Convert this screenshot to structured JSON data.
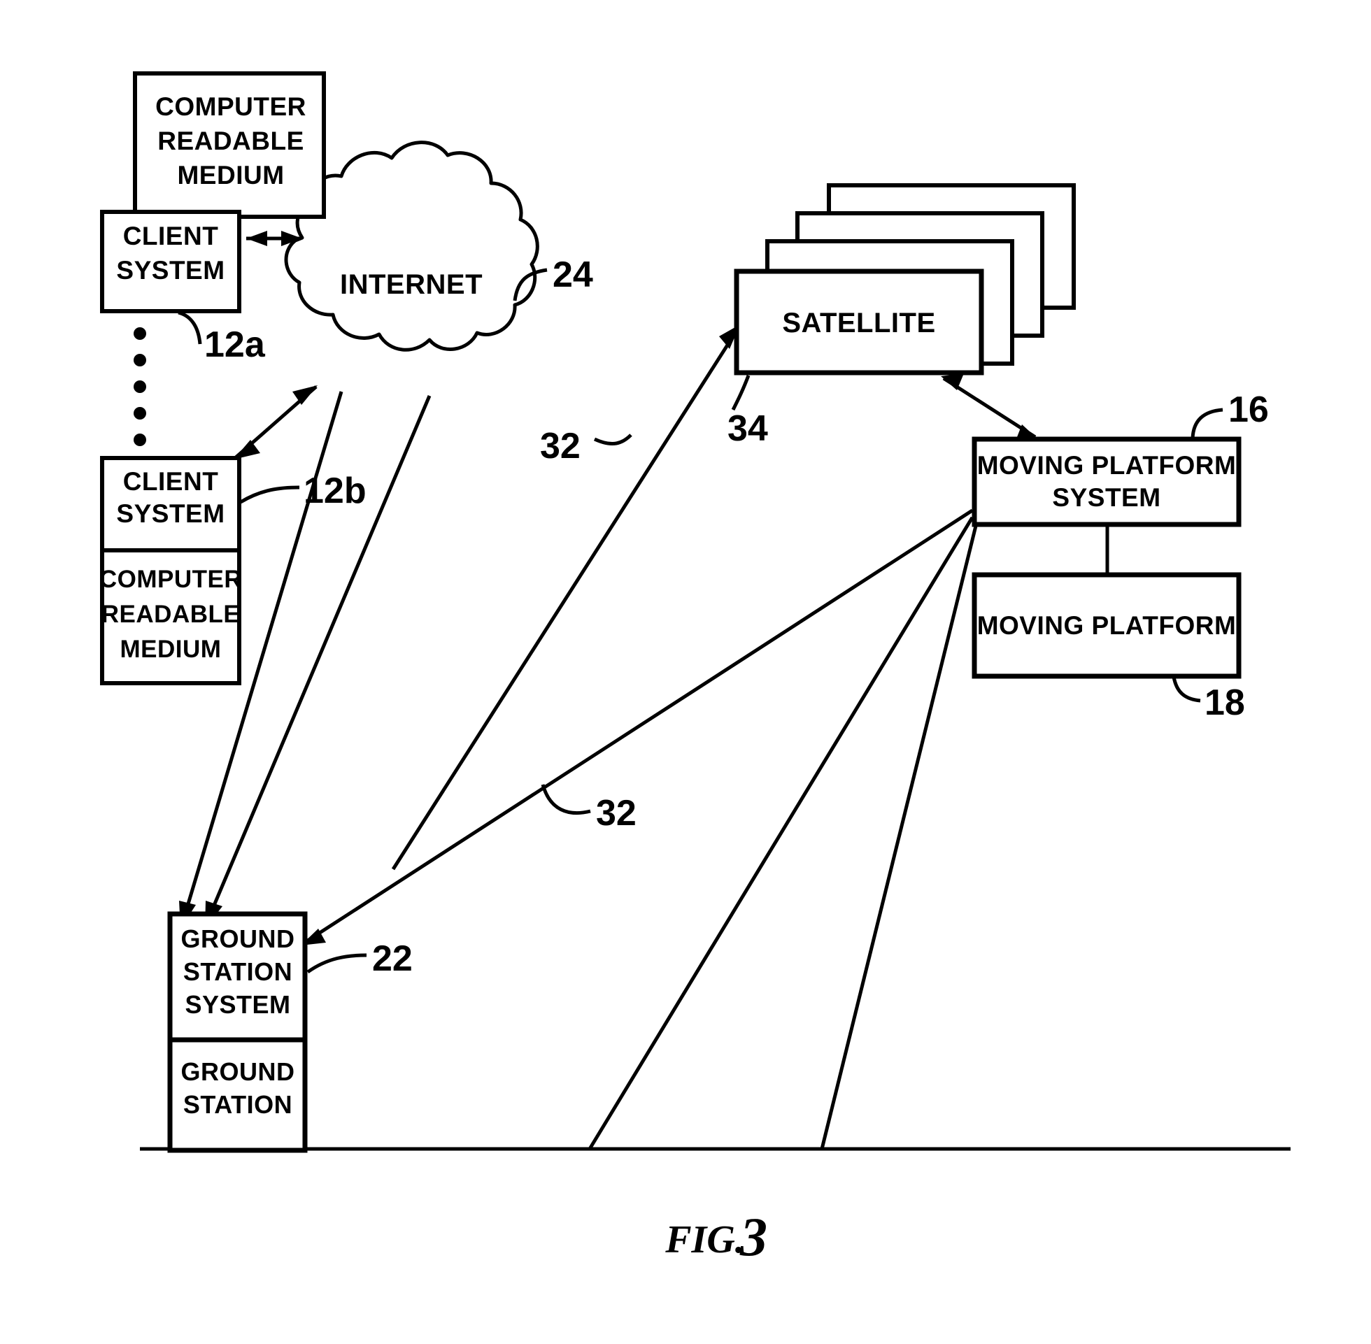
{
  "figure": {
    "caption_prefix": "FIG.",
    "caption_number": "3",
    "title": "Network diagram of client systems, internet, satellite, ground station and moving platform"
  },
  "nodes": {
    "computer_readable_medium_top": {
      "line1": "COMPUTER",
      "line2": "READABLE",
      "line3": "MEDIUM"
    },
    "client_system_a": {
      "line1": "CLIENT",
      "line2": "SYSTEM",
      "ref": "12a"
    },
    "client_system_b": {
      "line1": "CLIENT",
      "line2": "SYSTEM",
      "ref": "12b"
    },
    "computer_readable_medium_bottom": {
      "line1": "COMPUTER",
      "line2": "READABLE",
      "line3": "MEDIUM"
    },
    "internet_cloud": {
      "label": "INTERNET",
      "ref": "24"
    },
    "satellite": {
      "label": "SATELLITE",
      "ref": "34",
      "stack_count": 4
    },
    "moving_platform_system": {
      "line1": "MOVING PLATFORM",
      "line2": "SYSTEM",
      "ref": "16"
    },
    "moving_platform": {
      "label": "MOVING PLATFORM",
      "ref": "18"
    },
    "ground_station_system": {
      "line1": "GROUND",
      "line2": "STATION",
      "line3": "SYSTEM",
      "ref": "22"
    },
    "ground_station": {
      "line1": "GROUND",
      "line2": "STATION"
    }
  },
  "link_labels": {
    "link_32_upper": "32",
    "link_32_lower": "32"
  },
  "ellipsis": {
    "dot_count": 5
  },
  "colors": {
    "stroke": "#000000",
    "fill": "#ffffff",
    "background": "#ffffff"
  }
}
